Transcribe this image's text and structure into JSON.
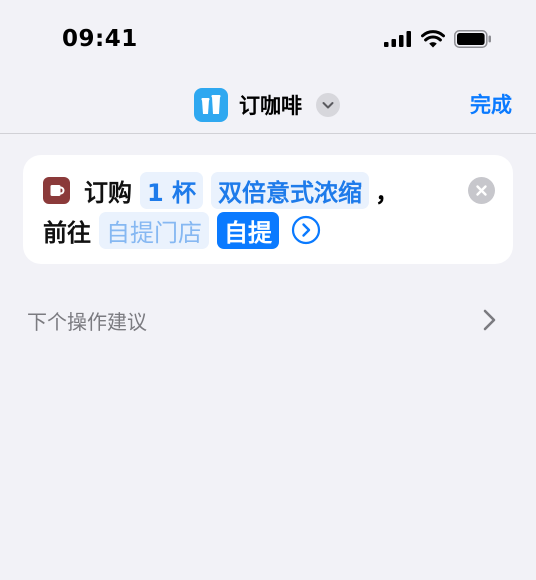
{
  "status": {
    "time": "09:41"
  },
  "nav": {
    "title": "订咖啡",
    "done_label": "完成"
  },
  "action": {
    "verb": "订购",
    "quantity": "1 杯",
    "drink": "双倍意式浓缩",
    "comma": "，",
    "go_to": "前往",
    "store_placeholder": "自提门店",
    "mode": "自提"
  },
  "suggestions": {
    "label": "下个操作建议"
  },
  "colors": {
    "accent": "#0A7AFF",
    "app_icon": "#2FA8F0",
    "cup_icon": "#8B3A3A"
  }
}
